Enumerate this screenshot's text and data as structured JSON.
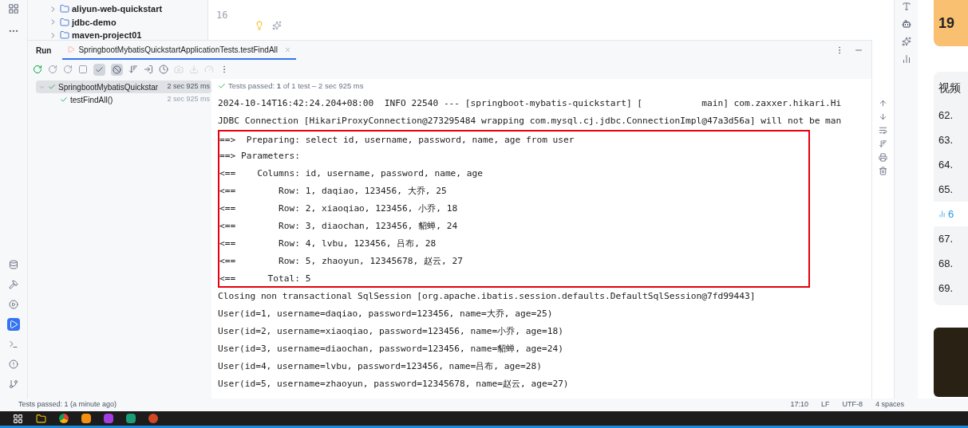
{
  "project_tree": [
    {
      "label": "aliyun-web-quickstart"
    },
    {
      "label": "jdbc-demo"
    },
    {
      "label": "maven-project01"
    }
  ],
  "editor": {
    "line_number": "16"
  },
  "run_panel": {
    "title": "Run",
    "tabs": [
      {
        "label": "SpringbootMybatisQuickstartApplicationTests.testFindAll",
        "selected": true
      }
    ],
    "filters": {
      "show_passed": true,
      "show_ignored": true
    }
  },
  "test_tree": [
    {
      "label": "SpringbootMybatisQuickstar",
      "duration": "2 sec 925 ms",
      "expanded": true,
      "selected": true,
      "children": [
        {
          "label": "testFindAll()",
          "duration": "2 sec 925 ms",
          "selected": false
        }
      ]
    }
  ],
  "console": {
    "summary": "Tests passed: **1** of 1 test – 2 sec 925 ms",
    "lines": [
      {
        "text": "2024-10-14T16:42:24.204+08:00  INFO 22540 --- [springboot-mybatis-quickstart] [           main] com.zaxxer.hikari.Hi",
        "highlighted": false
      },
      {
        "text": "JDBC Connection [HikariProxyConnection@273295484 wrapping com.mysql.cj.jdbc.ConnectionImpl@47a3d56a] will not be man",
        "highlighted": false
      },
      {
        "text": "==>  Preparing: select id, username, password, name, age from user",
        "highlighted": true
      },
      {
        "text": "==> Parameters: ",
        "highlighted": true
      },
      {
        "text": "<==    Columns: id, username, password, name, age",
        "highlighted": true
      },
      {
        "text": "<==        Row: 1, daqiao, 123456, 大乔, 25",
        "highlighted": true
      },
      {
        "text": "<==        Row: 2, xiaoqiao, 123456, 小乔, 18",
        "highlighted": true
      },
      {
        "text": "<==        Row: 3, diaochan, 123456, 貂蝉, 24",
        "highlighted": true
      },
      {
        "text": "<==        Row: 4, lvbu, 123456, 吕布, 28",
        "highlighted": true
      },
      {
        "text": "<==        Row: 5, zhaoyun, 12345678, 赵云, 27",
        "highlighted": true
      },
      {
        "text": "<==      Total: 5",
        "highlighted": true
      },
      {
        "text": "Closing non transactional SqlSession [org.apache.ibatis.session.defaults.DefaultSqlSession@7fd99443]",
        "highlighted": false
      },
      {
        "text": "User(id=1, username=daqiao, password=123456, name=大乔, age=25)",
        "highlighted": false
      },
      {
        "text": "User(id=2, username=xiaoqiao, password=123456, name=小乔, age=18)",
        "highlighted": false
      },
      {
        "text": "User(id=3, username=diaochan, password=123456, name=貂蝉, age=24)",
        "highlighted": false
      },
      {
        "text": "User(id=4, username=lvbu, password=123456, name=吕布, age=28)",
        "highlighted": false
      },
      {
        "text": "User(id=5, username=zhaoyun, password=12345678, name=赵云, age=27)",
        "highlighted": false
      }
    ]
  },
  "tool_windows": [
    {
      "kind": "database",
      "active": false
    },
    {
      "kind": "build",
      "active": false
    },
    {
      "kind": "services",
      "active": false
    },
    {
      "kind": "run",
      "active": true
    },
    {
      "kind": "terminal",
      "active": false
    },
    {
      "kind": "problems",
      "active": false
    },
    {
      "kind": "git",
      "active": false
    }
  ],
  "status_bar": {
    "message": "Tests passed: 1 (a minute ago)",
    "items": [
      "17:10",
      "LF",
      "UTF-8",
      "4 spaces"
    ]
  },
  "web_panel": {
    "promo": "19",
    "title": "视频",
    "episodes": [
      {
        "label": "62.",
        "selected": false
      },
      {
        "label": "63.",
        "selected": false
      },
      {
        "label": "64.",
        "selected": false
      },
      {
        "label": "65.",
        "selected": false
      },
      {
        "label": "6",
        "selected": true
      },
      {
        "label": "67.",
        "selected": false
      },
      {
        "label": "68.",
        "selected": false
      },
      {
        "label": "69.",
        "selected": false
      }
    ]
  }
}
